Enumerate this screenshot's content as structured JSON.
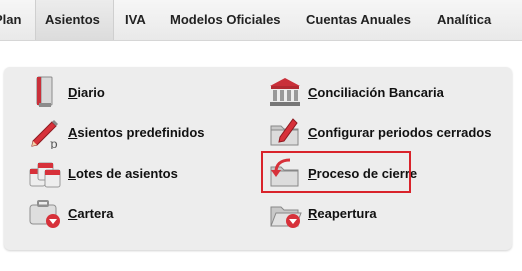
{
  "menubar": {
    "items": [
      {
        "label": "Plan"
      },
      {
        "label": "Asientos"
      },
      {
        "label": "IVA"
      },
      {
        "label": "Modelos Oficiales"
      },
      {
        "label": "Cuentas Anuales"
      },
      {
        "label": "Analítica"
      }
    ],
    "active_index": 1
  },
  "dropdown": {
    "left_column": [
      {
        "label": "Diario",
        "icon": "book-icon"
      },
      {
        "label": "Asientos predefinidos",
        "icon": "pencil-icon"
      },
      {
        "label": "Lotes de asientos",
        "icon": "calendar-stack-icon"
      },
      {
        "label": "Cartera",
        "icon": "briefcase-icon"
      }
    ],
    "right_column": [
      {
        "label": "Conciliación Bancaria",
        "icon": "bank-icon"
      },
      {
        "label": "Configurar periodos cerrados",
        "icon": "folder-edit-icon"
      },
      {
        "label": "Proceso de cierre",
        "icon": "folder-arrow-icon"
      },
      {
        "label": "Reapertura",
        "icon": "folder-open-icon"
      }
    ],
    "highlighted_item": "Proceso de cierre"
  },
  "colors": {
    "accent_red": "#d9232b",
    "panel_bg": "#ededed",
    "menubar_bg": "#efefef"
  }
}
